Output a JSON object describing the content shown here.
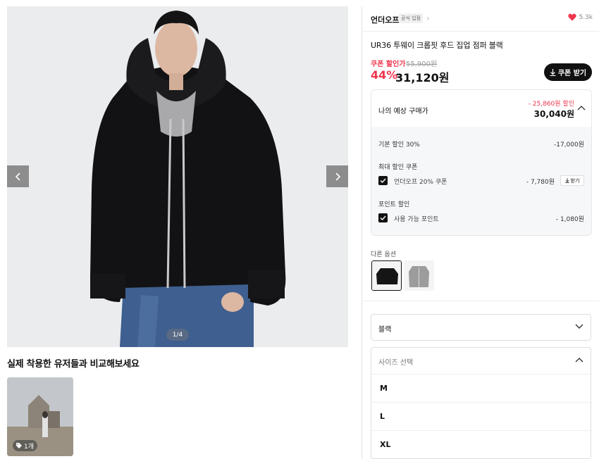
{
  "gallery": {
    "counter": "1/4",
    "compare_title": "실제 착용한 유저들과 비교해보세요",
    "snap_count": "1개"
  },
  "product": {
    "brand": "언더오프",
    "brand_badge": "공식 입점",
    "likes": "5.3k",
    "title": "UR36 투웨이 크롭핏 후드 집업 점퍼 블랙",
    "coupon_label": "쿠폰 할인가",
    "original_price": "55,900원",
    "discount_rate": "44%",
    "price": "31,120원",
    "coupon_button": "쿠폰 받기"
  },
  "estimate": {
    "label": "나의 예상 구매가",
    "total_discount": "- 25,860원 할인",
    "price": "30,040원",
    "base_label": "기본 할인 30%",
    "base_value": "-17,000원",
    "coupon_section": "최대 할인 쿠폰",
    "coupon_name": "언더오프 20% 쿠폰",
    "coupon_value": "- 7,780원",
    "coupon_get": "받기",
    "point_section": "포인트 할인",
    "point_name": "사용 가능 포인트",
    "point_value": "- 1,080원"
  },
  "options": {
    "other_label": "다른 옵션",
    "color_selected": "블랙",
    "size_placeholder": "사이즈 선택",
    "sizes": [
      "M",
      "L",
      "XL"
    ]
  },
  "colors": {
    "accent_red": "#f0364e",
    "heart": "#f0364e",
    "dark": "#111111"
  }
}
